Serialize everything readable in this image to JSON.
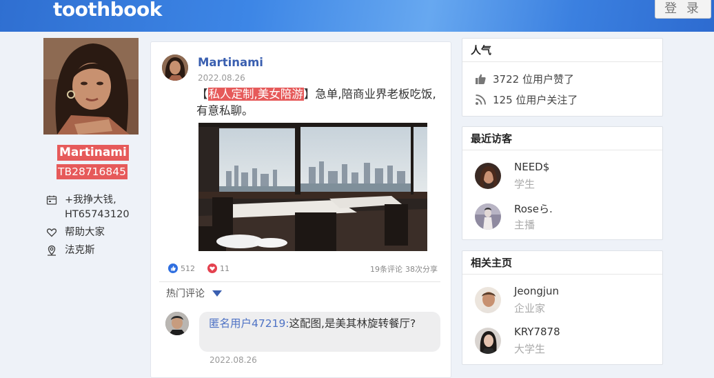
{
  "header": {
    "logo": "toothbook",
    "login_label": "登 录",
    "brand_color": "#3d86e6"
  },
  "profile": {
    "name": "Martinami",
    "id": "TB28716845",
    "info": [
      {
        "icon": "calendar-icon",
        "text": "+我挣大钱,\nHT65743120"
      },
      {
        "icon": "heart-outline-icon",
        "text": "帮助大家"
      },
      {
        "icon": "location-pin-icon",
        "text": "法克斯"
      }
    ]
  },
  "post": {
    "author": "Martinami",
    "date": "2022.08.26",
    "text_open": "【",
    "text_highlight": "私人定制,美女陪游",
    "text_close": "】",
    "text_rest": "急单,陪商业界老板吃饭,有意私聊。",
    "likes": "512",
    "hearts": "11",
    "comments": "19条评论",
    "shares": "38次分享",
    "hot_comments_label": "热门评论",
    "comment": {
      "user": "匿名用户47219:",
      "text": "这配图,是美其林旋转餐厅?",
      "date": "2022.08.26"
    }
  },
  "popularity": {
    "title": "人气",
    "likes_text": "3722 位用户赞了",
    "follows_text": "125 位用户关注了"
  },
  "visitors": {
    "title": "最近访客",
    "items": [
      {
        "name": "NEED$",
        "role": "学生"
      },
      {
        "name": "Roseら.",
        "role": "主播"
      }
    ]
  },
  "related": {
    "title": "相关主页",
    "items": [
      {
        "name": "Jeongjun",
        "role": "企业家"
      },
      {
        "name": "KRY7878",
        "role": "大学生"
      }
    ]
  }
}
